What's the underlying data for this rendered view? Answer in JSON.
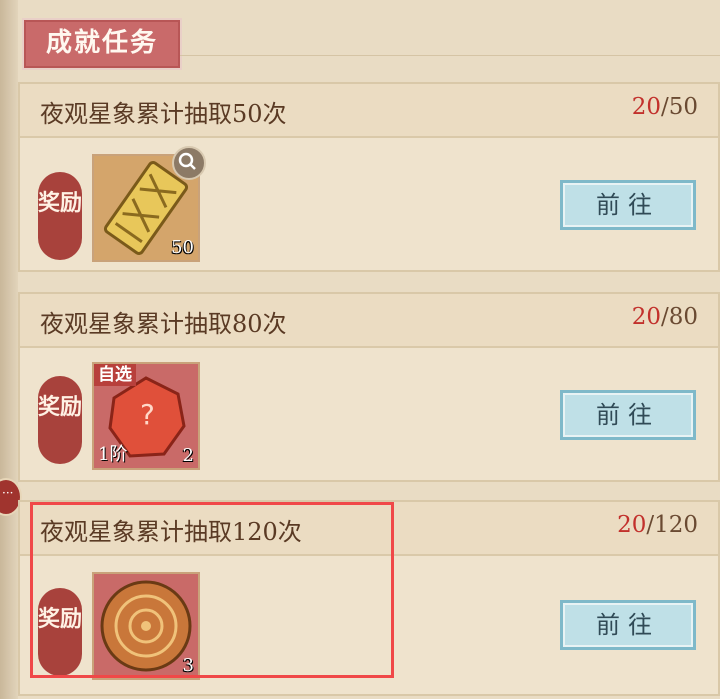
{
  "section": {
    "title": "成就任务"
  },
  "tasks": [
    {
      "title": "夜观星象累计抽取50次",
      "progress_current": "20",
      "progress_total": "/50",
      "reward_label": "奖励",
      "item": {
        "icon": "gold-scroll-icon",
        "count": "50",
        "ribbon": "",
        "tier": ""
      },
      "button": "前往"
    },
    {
      "title": "夜观星象累计抽取80次",
      "progress_current": "20",
      "progress_total": "/80",
      "reward_label": "奖励",
      "item": {
        "icon": "red-crystal-icon",
        "count": "2",
        "ribbon": "自选",
        "tier": "1阶"
      },
      "button": "前往"
    },
    {
      "title": "夜观星象累计抽取120次",
      "progress_current": "20",
      "progress_total": "/120",
      "reward_label": "奖励",
      "item": {
        "icon": "bronze-disc-icon",
        "count": "3",
        "ribbon": "",
        "tier": ""
      },
      "button": "前往"
    }
  ],
  "colors": {
    "accent_red": "#c2312c",
    "button_blue": "#bfe0e7",
    "highlight": "#f04848"
  }
}
